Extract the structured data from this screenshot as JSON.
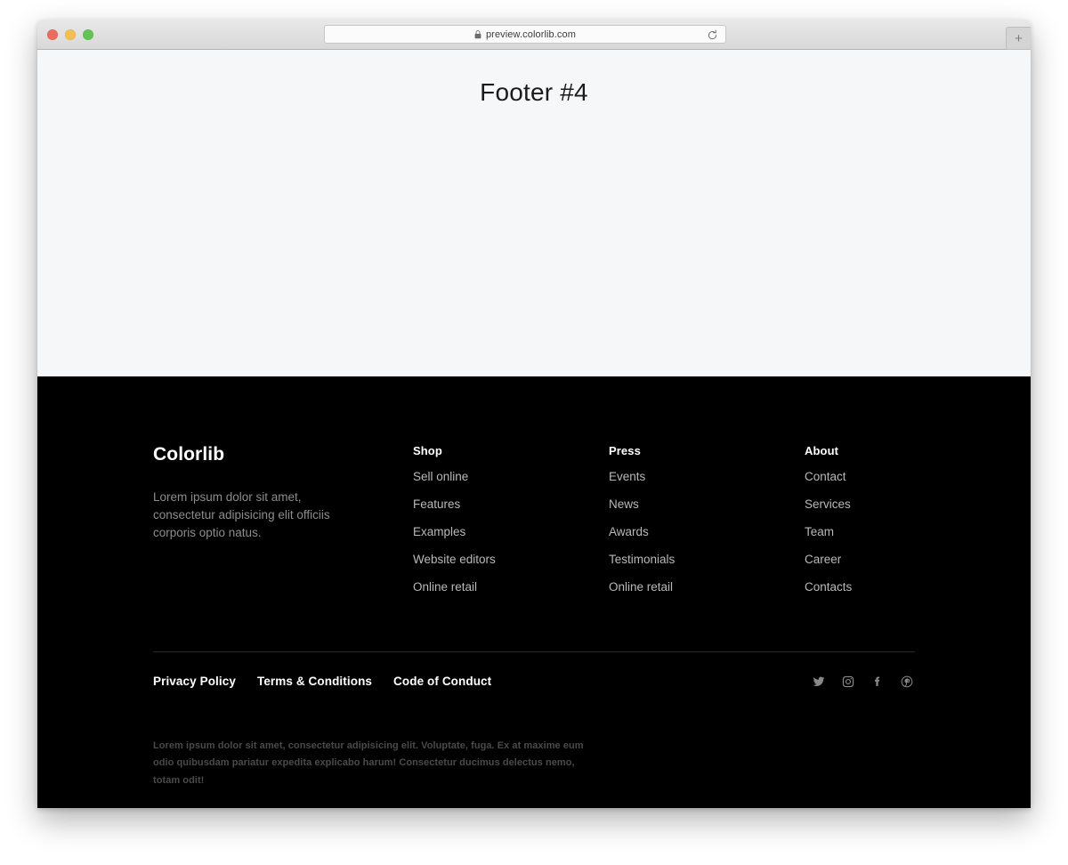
{
  "browser": {
    "traffic_lights": [
      {
        "name": "close",
        "color": "#ED6A5E"
      },
      {
        "name": "minimize",
        "color": "#F5BF4F"
      },
      {
        "name": "maximize",
        "color": "#61C554"
      }
    ],
    "url": "preview.colorlib.com",
    "lock_icon": "lock-icon",
    "reload_icon": "reload-icon",
    "newtab_label": "+"
  },
  "hero": {
    "title": "Footer #4"
  },
  "footer": {
    "brand": {
      "name": "Colorlib",
      "description": "Lorem ipsum dolor sit amet, consectetur adipisicing elit officiis corporis optio natus."
    },
    "columns": [
      {
        "heading": "Shop",
        "links": [
          "Sell online",
          "Features",
          "Examples",
          "Website editors",
          "Online retail"
        ]
      },
      {
        "heading": "Press",
        "links": [
          "Events",
          "News",
          "Awards",
          "Testimonials",
          "Online retail"
        ]
      },
      {
        "heading": "About",
        "links": [
          "Contact",
          "Services",
          "Team",
          "Career",
          "Contacts"
        ]
      }
    ],
    "legal_links": [
      "Privacy Policy",
      "Terms & Conditions",
      "Code of Conduct"
    ],
    "social_links": [
      {
        "name": "twitter-icon",
        "label": "Twitter"
      },
      {
        "name": "instagram-icon",
        "label": "Instagram"
      },
      {
        "name": "facebook-icon",
        "label": "Facebook"
      },
      {
        "name": "pinterest-icon",
        "label": "Pinterest"
      }
    ],
    "copyright": "Lorem ipsum dolor sit amet, consectetur adipisicing elit. Voluptate, fuga. Ex at maxime eum odio quibusdam pariatur expedita explicabo harum! Consectetur ducimus delectus nemo, totam odit!",
    "colors": {
      "background": "#000000",
      "heading_text": "#ffffff",
      "link_text": "#b9b9b9",
      "muted_text": "#8d8d8d",
      "divider": "#2a2a2a"
    }
  }
}
